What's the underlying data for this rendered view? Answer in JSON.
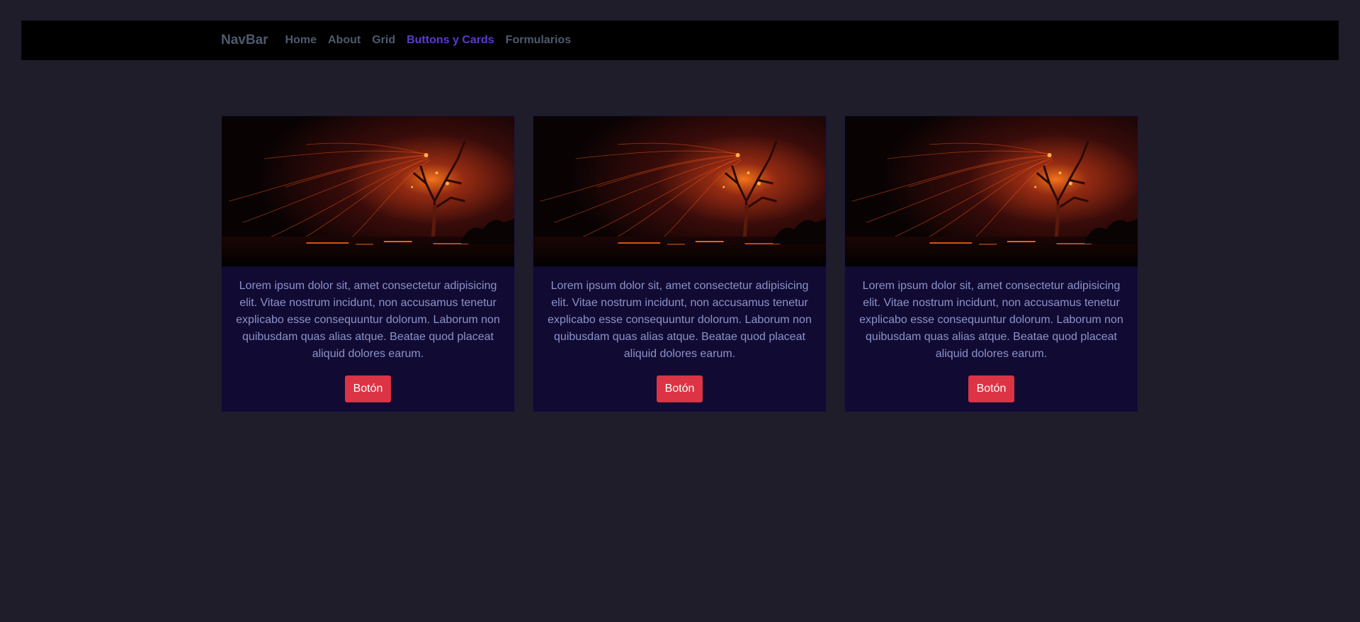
{
  "navbar": {
    "brand": "NavBar",
    "links": [
      {
        "label": "Home",
        "active": false
      },
      {
        "label": "About",
        "active": false
      },
      {
        "label": "Grid",
        "active": false
      },
      {
        "label": "Buttons y Cards",
        "active": true
      },
      {
        "label": "Formularios",
        "active": false
      }
    ]
  },
  "cards": [
    {
      "image": "fire-tree-night-photo",
      "text": "Lorem ipsum dolor sit, amet consectetur adipisicing elit. Vitae nostrum incidunt, non accusamus tenetur explicabo esse consequuntur dolorum. Laborum non quibusdam quas alias atque. Beatae quod placeat aliquid dolores earum.",
      "button": "Botón"
    },
    {
      "image": "fire-tree-night-photo",
      "text": "Lorem ipsum dolor sit, amet consectetur adipisicing elit. Vitae nostrum incidunt, non accusamus tenetur explicabo esse consequuntur dolorum. Laborum non quibusdam quas alias atque. Beatae quod placeat aliquid dolores earum.",
      "button": "Botón"
    },
    {
      "image": "fire-tree-night-photo",
      "text": "Lorem ipsum dolor sit, amet consectetur adipisicing elit. Vitae nostrum incidunt, non accusamus tenetur explicabo esse consequuntur dolorum. Laborum non quibusdam quas alias atque. Beatae quod placeat aliquid dolores earum.",
      "button": "Botón"
    }
  ],
  "colors": {
    "background": "#1f1d29",
    "navbar": "#000000",
    "nav_link": "#4d5a6e",
    "nav_active": "#5b3ad1",
    "card_bg": "#110a33",
    "card_text": "#8b93c9",
    "button": "#dc3445"
  }
}
